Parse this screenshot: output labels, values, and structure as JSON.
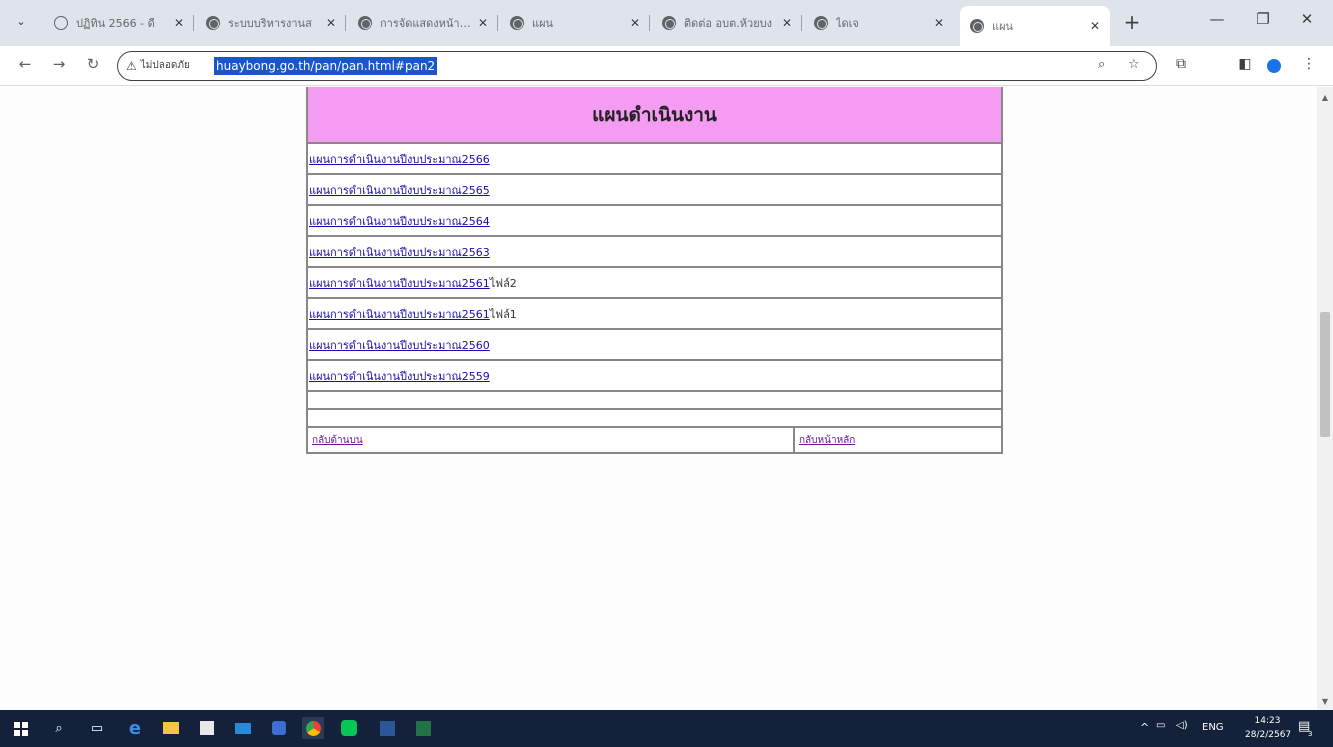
{
  "browser": {
    "tabs": [
      {
        "title": "ปฏิทิน 2566 - ดื",
        "favicon": "calendar-icon"
      },
      {
        "title": "ระบบบริหารงานส",
        "favicon": "globe-icon"
      },
      {
        "title": "การจัดแสดงหน้าเว็บ",
        "favicon": "globe-icon"
      },
      {
        "title": "แผน",
        "favicon": "globe-icon"
      },
      {
        "title": "ติดต่อ อบต.ห้วยบง",
        "favicon": "globe-icon"
      },
      {
        "title": "ไดเจ",
        "favicon": "globe-icon"
      },
      {
        "title": "แผน",
        "favicon": "globe-icon",
        "active": true
      }
    ],
    "address": {
      "security_label": "ไม่ปลอดภัย",
      "url": "huaybong.go.th/pan/pan.html#pan2"
    }
  },
  "page": {
    "heading": "แผนดำเนินงาน",
    "links": [
      {
        "label": "แผนการดำเนินงานปีงบประมาณ2566",
        "suffix": ""
      },
      {
        "label": "แผนการดำเนินงานปีงบประมาณ2565",
        "suffix": ""
      },
      {
        "label": "แผนการดำเนินงานปีงบประมาณ2564",
        "suffix": ""
      },
      {
        "label": "แผนการดำเนินงานปีงบประมาณ2563",
        "suffix": ""
      },
      {
        "label": "แผนการดำเนินงานปีงบประมาณ2561",
        "suffix": "ไฟล์2"
      },
      {
        "label": "แผนการดำเนินงานปีงบประมาณ2561",
        "suffix": "ไฟล์1"
      },
      {
        "label": "แผนการดำเนินงานปีงบประมาณ2560",
        "suffix": ""
      },
      {
        "label": "แผนการดำเนินงานปีงบประมาณ2559",
        "suffix": ""
      }
    ],
    "footer": {
      "back_label": "กลับด้านบน",
      "home_label": "กลับหน้าหลัก"
    }
  },
  "taskbar": {
    "language": "ENG",
    "time": "14:23",
    "date": "28/2/2567",
    "notification_count": "3"
  },
  "colors": {
    "header_bg": "#f39cf2",
    "url_highlight": "#1a56c8",
    "taskbar_bg": "#14213a"
  }
}
